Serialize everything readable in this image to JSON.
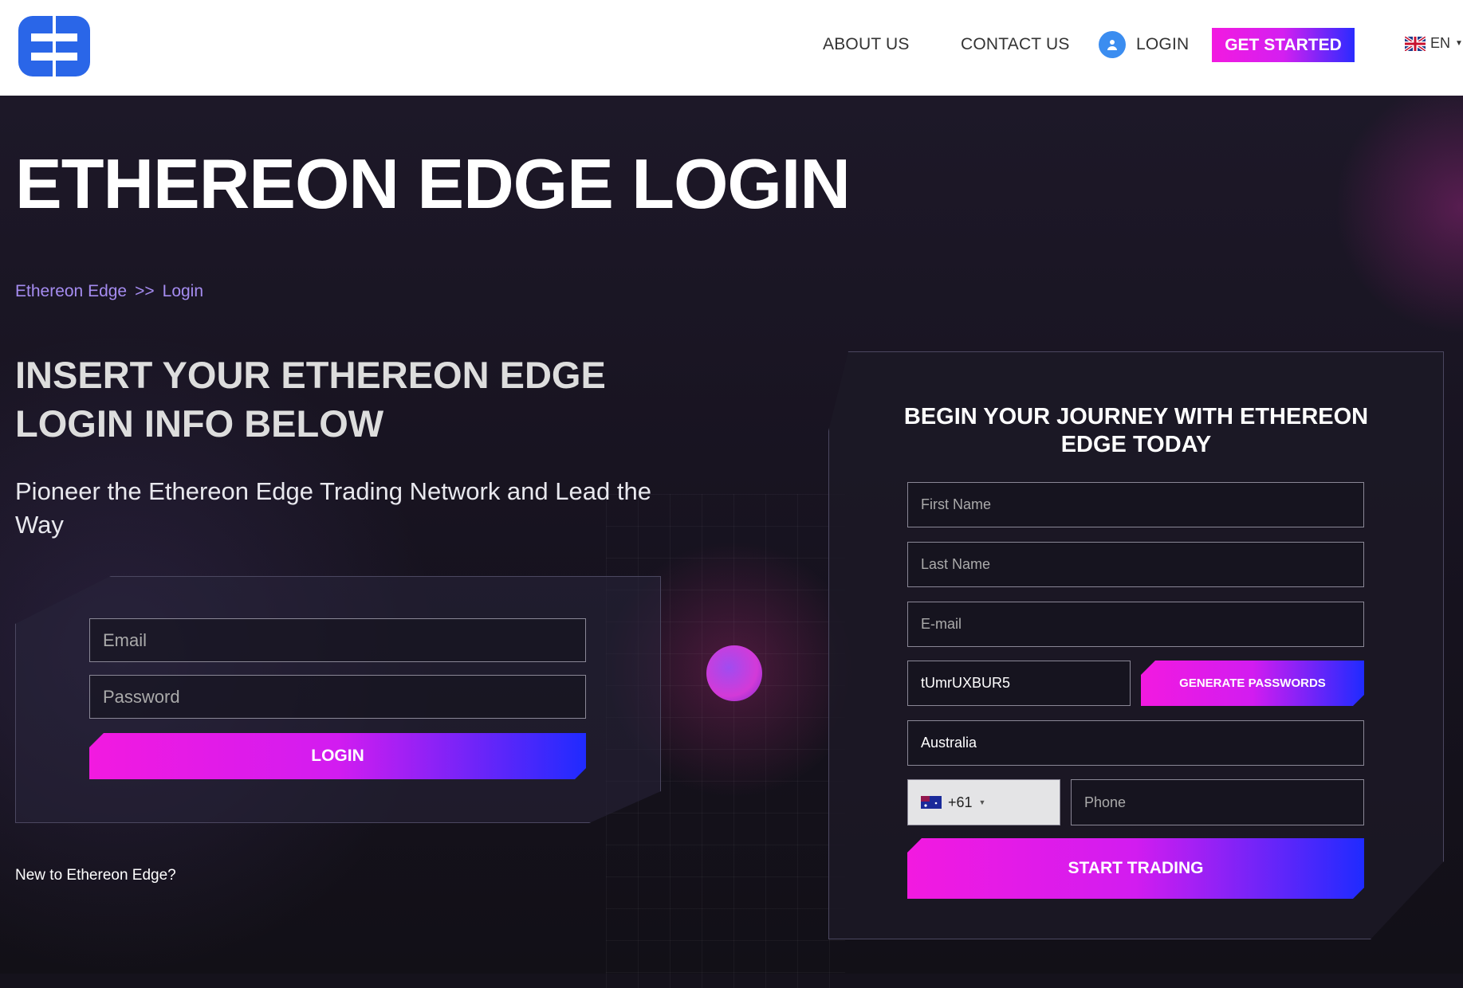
{
  "header": {
    "nav": [
      "ABOUT US",
      "CONTACT US"
    ],
    "login": "LOGIN",
    "get_started": "GET STARTED",
    "language": "EN",
    "accent_gradient": [
      "#f21ae0",
      "#2a2bff"
    ]
  },
  "hero": {
    "title": "ETHEREON EDGE LOGIN",
    "breadcrumb": [
      "Ethereon Edge",
      ">>",
      "Login"
    ],
    "heading": "INSERT YOUR ETHEREON EDGE LOGIN INFO BELOW",
    "subheading": "Pioneer the Ethereon Edge Trading Network and Lead the Way"
  },
  "login_form": {
    "email_placeholder": "Email",
    "password_placeholder": "Password",
    "login_button": "LOGIN",
    "new_user_text": "New to Ethereon Edge?"
  },
  "signup_form": {
    "title": "BEGIN YOUR JOURNEY WITH ETHEREON EDGE TODAY",
    "first_name_placeholder": "First Name",
    "last_name_placeholder": "Last Name",
    "email_placeholder": "E-mail",
    "password_value": "tUmrUXBUR5",
    "generate_button": "GENERATE PASSWORDS",
    "country_value": "Australia",
    "dial_code": "+61",
    "phone_placeholder": "Phone",
    "submit_button": "START TRADING"
  }
}
